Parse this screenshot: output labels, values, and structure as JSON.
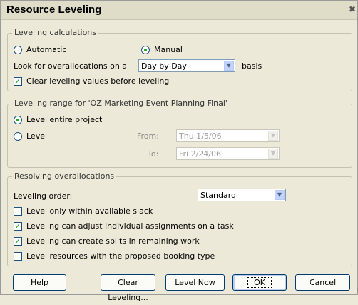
{
  "window": {
    "title": "Resource Leveling"
  },
  "calc": {
    "legend": "Leveling calculations",
    "automatic": "Automatic",
    "manual": "Manual",
    "look_label": "Look for overallocations on a",
    "look_value": "Day by Day",
    "basis": "basis",
    "clear_values": "Clear leveling values before leveling"
  },
  "range": {
    "legend": "Leveling range for 'OZ Marketing Event Planning Final'",
    "entire": "Level entire project",
    "level": "Level",
    "from_label": "From:",
    "from_value": "Thu 1/5/06",
    "to_label": "To:",
    "to_value": "Fri 2/24/06"
  },
  "resolve": {
    "legend": "Resolving overallocations",
    "order_label": "Leveling order:",
    "order_value": "Standard",
    "opt1": "Level only within available slack",
    "opt2": "Leveling can adjust individual assignments on a task",
    "opt3": "Leveling can create splits in remaining work",
    "opt4": "Level resources with the proposed booking type"
  },
  "buttons": {
    "help": "Help",
    "clear": "Clear Leveling...",
    "level_now": "Level Now",
    "ok": "OK",
    "cancel": "Cancel"
  },
  "state": {
    "automatic": false,
    "manual": true,
    "clear_values": true,
    "entire": true,
    "level_range": false,
    "opt1": false,
    "opt2": true,
    "opt3": true,
    "opt4": false
  }
}
